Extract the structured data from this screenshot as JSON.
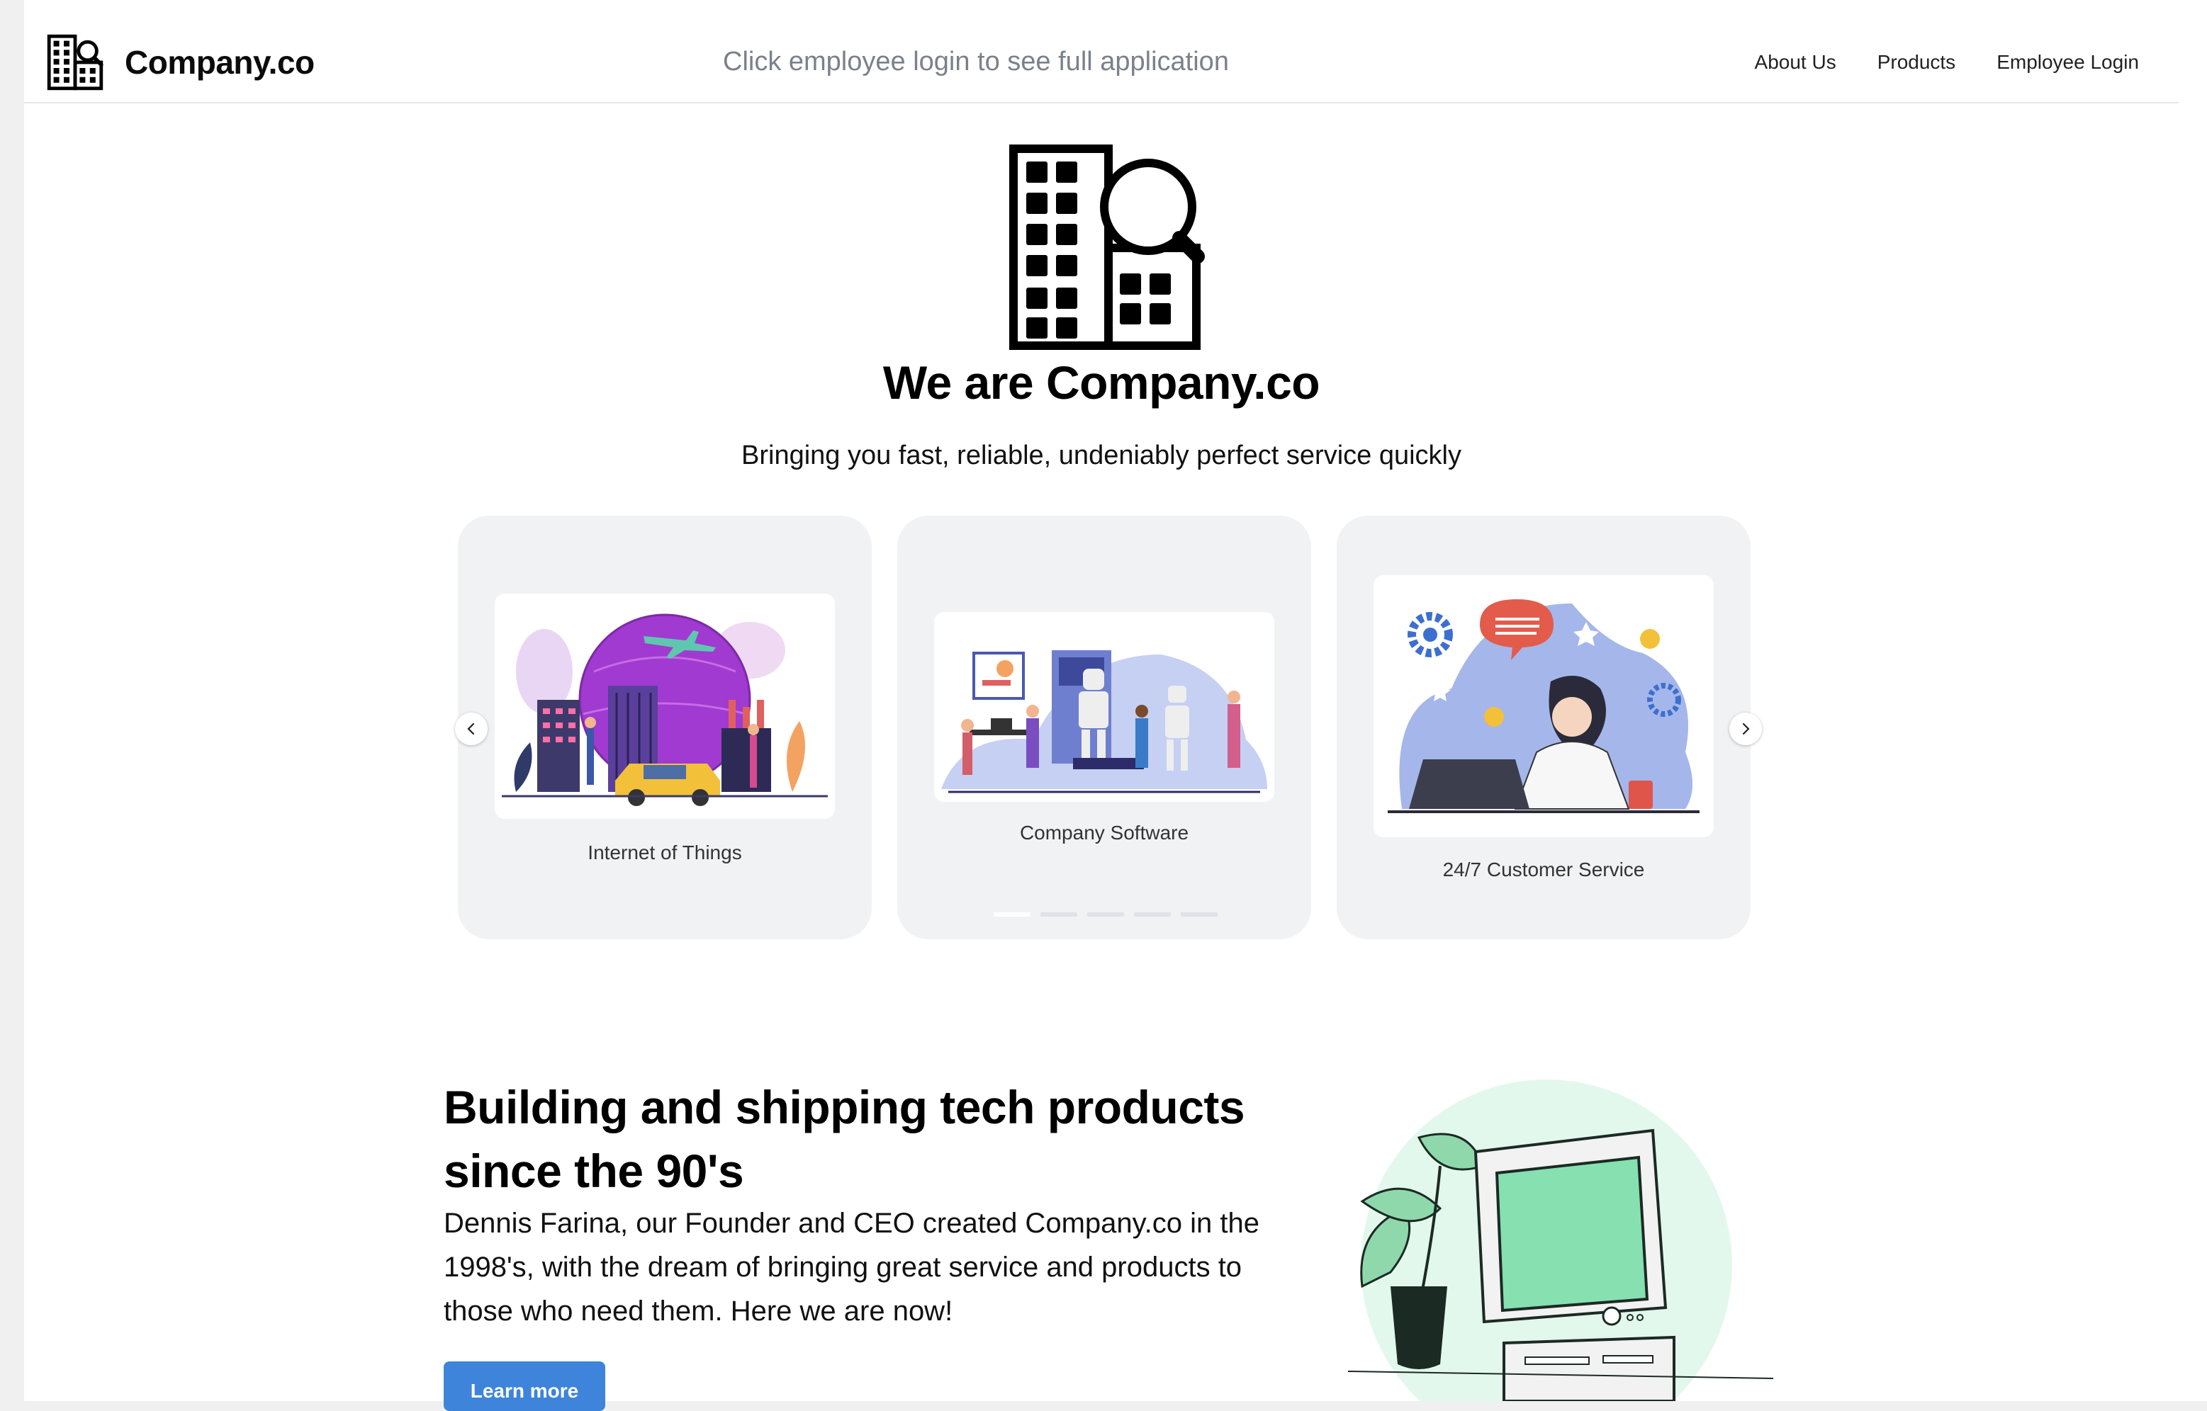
{
  "header": {
    "brand_name": "Company.co",
    "tagline": "Click employee login to see full application",
    "nav": [
      {
        "label": "About Us"
      },
      {
        "label": "Products"
      },
      {
        "label": "Employee Login"
      }
    ]
  },
  "hero": {
    "title": "We are Company.co",
    "subtitle": "Bringing you fast, reliable, undeniably perfect service quickly"
  },
  "carousel": {
    "cards": [
      {
        "caption": "Internet of Things",
        "illustration": "iot-city-illustration"
      },
      {
        "caption": "Company Software",
        "illustration": "robots-software-illustration"
      },
      {
        "caption": "24/7 Customer Service",
        "illustration": "customer-service-illustration"
      }
    ],
    "prev_icon": "chevron-left-icon",
    "next_icon": "chevron-right-icon",
    "dot_count": 5,
    "active_dot": 1
  },
  "about": {
    "title": "Building and shipping tech products since the 90's",
    "body": "Dennis Farina, our Founder and CEO created Company.co in the 1998's, with the dream of bringing great service and products to those who need them. Here we are now!",
    "button_label": "Learn more"
  },
  "colors": {
    "accent_button": "#3d84da",
    "card_bg": "#f1f2f4",
    "tagline": "#7b818a",
    "computer_screen": "#86e0b0",
    "computer_blob": "#e3f8ec"
  }
}
